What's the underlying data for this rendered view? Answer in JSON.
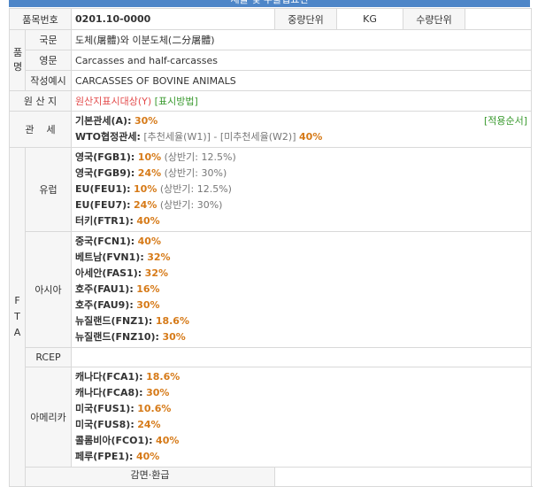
{
  "header": {
    "title": "세율 및 수출입요건"
  },
  "item_no": {
    "label": "품목번호",
    "value": "0201.10-0000"
  },
  "weight_unit": {
    "label": "중량단위",
    "value": "KG"
  },
  "qty_unit": {
    "label": "수량단위",
    "value": ""
  },
  "product_name": {
    "group_label_chars": [
      "품",
      "명"
    ],
    "korean": {
      "label": "국문",
      "value": "도체(屠體)와 이분도체(二分屠體)"
    },
    "english": {
      "label": "영문",
      "value": "Carcasses and half-carcasses"
    },
    "example": {
      "label": "작성예시",
      "value": "CARCASSES OF BOVINE ANIMALS"
    }
  },
  "origin": {
    "label": "원 산 지",
    "link1": "원산지표시대상(Y)",
    "link2": "[표시방법]"
  },
  "tariff": {
    "label": "관    세",
    "basic_label": "기본관세(A):",
    "basic_rate": "30%",
    "apply_order": "[적용순서]",
    "wto_label": "WTO협정관세:",
    "wto_detail": "[추천세율(W1)] -  [미추천세율(W2)]",
    "wto_rate": "40%"
  },
  "fta": {
    "label_chars": [
      "F",
      "T",
      "A"
    ],
    "groups": [
      {
        "name": "유럽",
        "rates": [
          {
            "name": "영국(FGB1):",
            "rate": "10%",
            "note": "(상반기: 12.5%)"
          },
          {
            "name": "영국(FGB9):",
            "rate": "24%",
            "note": "(상반기: 30%)"
          },
          {
            "name": "EU(FEU1):",
            "rate": "10%",
            "note": "(상반기: 12.5%)"
          },
          {
            "name": "EU(FEU7):",
            "rate": "24%",
            "note": "(상반기: 30%)"
          },
          {
            "name": "터키(FTR1):",
            "rate": "40%",
            "note": ""
          }
        ]
      },
      {
        "name": "아시아",
        "rates": [
          {
            "name": "중국(FCN1):",
            "rate": "40%",
            "note": ""
          },
          {
            "name": "베트남(FVN1):",
            "rate": "32%",
            "note": ""
          },
          {
            "name": "아세안(FAS1):",
            "rate": "32%",
            "note": ""
          },
          {
            "name": "호주(FAU1):",
            "rate": "16%",
            "note": ""
          },
          {
            "name": "호주(FAU9):",
            "rate": "30%",
            "note": ""
          },
          {
            "name": "뉴질랜드(FNZ1):",
            "rate": "18.6%",
            "note": ""
          },
          {
            "name": "뉴질랜드(FNZ10):",
            "rate": "30%",
            "note": ""
          }
        ]
      },
      {
        "name": "RCEP",
        "rates": []
      },
      {
        "name": "아메리카",
        "rates": [
          {
            "name": "캐나다(FCA1):",
            "rate": "18.6%",
            "note": ""
          },
          {
            "name": "캐나다(FCA8):",
            "rate": "30%",
            "note": ""
          },
          {
            "name": "미국(FUS1):",
            "rate": "10.6%",
            "note": ""
          },
          {
            "name": "미국(FUS8):",
            "rate": "24%",
            "note": ""
          },
          {
            "name": "콜롬비아(FCO1):",
            "rate": "40%",
            "note": ""
          },
          {
            "name": "페루(FPE1):",
            "rate": "40%",
            "note": ""
          }
        ]
      }
    ]
  },
  "reduction": {
    "label": "감면·환급"
  },
  "colors": {
    "rate": "#d67a18",
    "link_green": "#3a9a2f",
    "link_red": "#e34c4c",
    "header_blue": "#4e86c8"
  }
}
